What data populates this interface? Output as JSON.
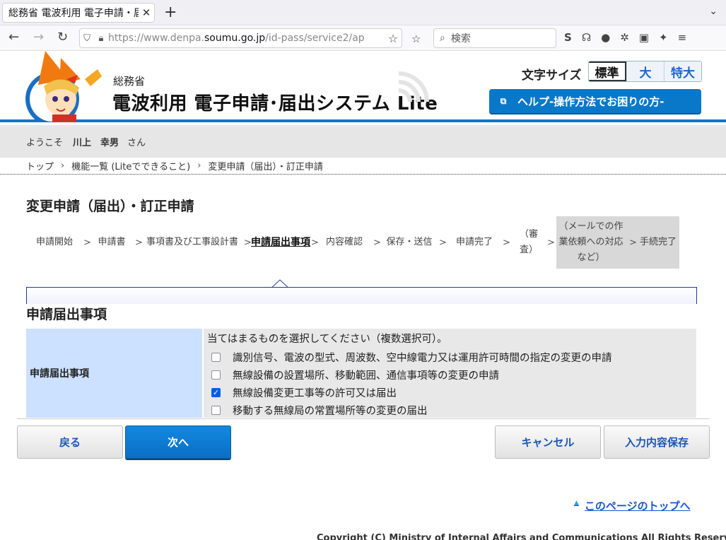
{
  "browser": {
    "tab_title": "総務省 電波利用 電子申請・届",
    "url_host_prefix": "https://www.denpa.",
    "url_host": "soumu.go.jp",
    "url_path": "/id-pass/service2/ap",
    "search_placeholder": "検索"
  },
  "header": {
    "ministry": "総務省",
    "system_title": "電波利用 電子申請･届出システム Lite",
    "font_size_label": "文字サイズ",
    "font_sizes": [
      "標準",
      "大",
      "特大"
    ],
    "help_label": "ヘルプ-操作方法でお困りの方-"
  },
  "welcome": {
    "prefix": "ようこそ",
    "user_name": "川上　幸男",
    "suffix": "さん"
  },
  "breadcrumb": [
    "トップ",
    "機能一覧 (Liteでできること)",
    "変更申請（届出）・訂正申請"
  ],
  "page_title": "変更申請（届出）・訂正申請",
  "steps": {
    "items": [
      "申請開始",
      "申請書",
      "事項書及び工事設計書",
      "申請届出事項",
      "内容確認",
      "保存・送信",
      "申請完了",
      "（審査）",
      "（メールでの作業依頼への対応など）",
      "手続完了"
    ],
    "current": "申請届出事項"
  },
  "section_title": "申請届出事項",
  "form": {
    "label": "申請届出事項",
    "instruction": "当てはまるものを選択してください（複数選択可）。",
    "options": [
      {
        "label": "識別信号、電波の型式、周波数、空中線電力又は運用許可時間の指定の変更の申請",
        "checked": false
      },
      {
        "label": "無線設備の設置場所、移動範囲、通信事項等の変更の申請",
        "checked": false
      },
      {
        "label": "無線設備変更工事等の許可又は届出",
        "checked": true
      },
      {
        "label": "移動する無線局の常置場所等の変更の届出",
        "checked": false
      }
    ]
  },
  "buttons": {
    "back": "戻る",
    "next": "次へ",
    "cancel": "キャンセル",
    "save": "入力内容保存"
  },
  "footer": {
    "to_top": "このページのトップへ",
    "copyright": "Copyright (C) Ministry of Internal Affairs and Communications All Rights Reserved."
  },
  "colors": {
    "brand_blue": "#0a78c8",
    "label_bg": "#cce0ff",
    "step_shade": "#d8d8d8"
  }
}
